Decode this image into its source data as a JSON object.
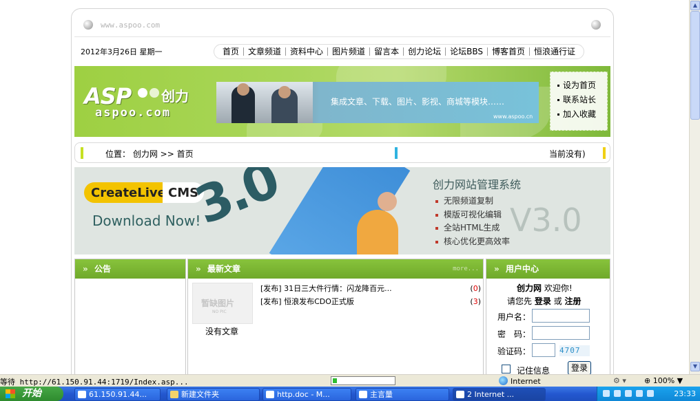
{
  "site": {
    "domain": "www.aspoo.com",
    "date": "2012年3月26日 星期一",
    "nav": [
      "首页",
      "文章频道",
      "资料中心",
      "图片频道",
      "留言本",
      "创力论坛",
      "论坛BBS",
      "博客首页",
      "恒浪通行证"
    ]
  },
  "header": {
    "logo_main": "ASP",
    "logo_cn": "创力",
    "logo_sub": "aspoo.com",
    "banner_text": "集成文章、下载、图片、影视、商城等模块……",
    "banner_site": "www.aspoo.cn",
    "quick_links": [
      "设为首页",
      "联系站长",
      "加入收藏"
    ]
  },
  "position": {
    "label": "位置：",
    "path": "创力网 >> 首页",
    "right_text": "当前没有)"
  },
  "cms": {
    "brand_a": "CreateLive",
    "brand_b": "CMS",
    "download": "Download Now!",
    "big_version": "3.0",
    "title": "创力网站管理系统",
    "features": [
      "无限频道复制",
      "模版可视化编辑",
      "全站HTML生成",
      "核心优化更高效率"
    ],
    "version": "V3.0"
  },
  "notice": {
    "title": "公告"
  },
  "articles": {
    "title": "最新文章",
    "more": "more...",
    "nopic_cn": "暂缺图片",
    "nopic_en": "NO PIC",
    "no_article": "没有文章",
    "items": [
      {
        "text": "[发布] 31日三大件行情：闪龙降百元...",
        "count_open": "(",
        "count": "0",
        "count_close": ")"
      },
      {
        "text": "[发布] 恒浪发布CDO正式版",
        "count_open": "(",
        "count": "3",
        "count_close": ")"
      }
    ]
  },
  "user": {
    "title": "用户中心",
    "welcome_site": "创力网",
    "welcome_text": "欢迎你!",
    "prompt_pre": "请您先",
    "login_word": "登录",
    "or_word": "或",
    "register_word": "注册",
    "username_label": "用户名：",
    "password_label": "密　码：",
    "captcha_label": "验证码：",
    "captcha_code": "4707",
    "remember_label": "记住信息",
    "login_button": "登录"
  },
  "statusbar": {
    "text": "等待 http://61.150.91.44:1719/Index.asp...",
    "progress": 0.07,
    "zone": "Internet",
    "zoom": "100%",
    "zoom_arrow": "▼"
  },
  "taskbar": {
    "start": "开始",
    "tasks": [
      "61.150.91.44...",
      "新建文件夹",
      "http.doc - M...",
      "主言量",
      "2 Internet ..."
    ],
    "clock": "23:33"
  },
  "colors": {
    "green_band": "#9ed042",
    "panel_title": "#78b232",
    "xp_blue": "#2458d0"
  }
}
